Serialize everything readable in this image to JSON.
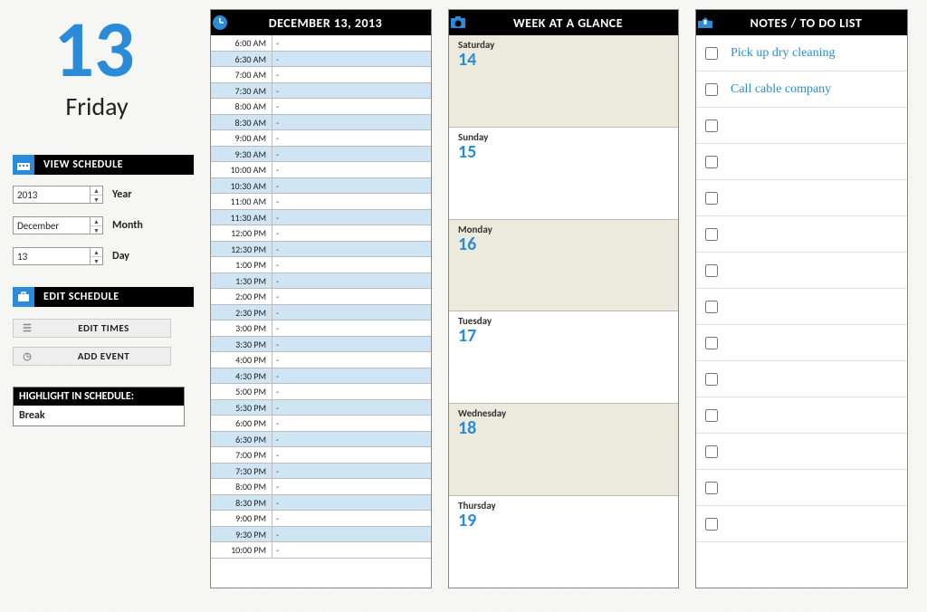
{
  "date": {
    "big": "13",
    "weekday": "Friday"
  },
  "view_schedule": {
    "title": "VIEW SCHEDULE",
    "year": {
      "value": "2013",
      "label": "Year"
    },
    "month": {
      "value": "December",
      "label": "Month"
    },
    "day": {
      "value": "13",
      "label": "Day"
    }
  },
  "edit_schedule": {
    "title": "EDIT SCHEDULE",
    "edit_times": "EDIT TIMES",
    "add_event": "ADD EVENT"
  },
  "highlight": {
    "title": "HIGHLIGHT IN SCHEDULE:",
    "value": "Break"
  },
  "schedule": {
    "title": "DECEMBER 13, 2013",
    "slots": [
      {
        "t": "6:00 AM",
        "e": "-"
      },
      {
        "t": "6:30 AM",
        "e": "-"
      },
      {
        "t": "7:00 AM",
        "e": "-"
      },
      {
        "t": "7:30 AM",
        "e": "-"
      },
      {
        "t": "8:00 AM",
        "e": "-"
      },
      {
        "t": "8:30 AM",
        "e": "-"
      },
      {
        "t": "9:00 AM",
        "e": "-"
      },
      {
        "t": "9:30 AM",
        "e": "-"
      },
      {
        "t": "10:00 AM",
        "e": "-"
      },
      {
        "t": "10:30 AM",
        "e": "-"
      },
      {
        "t": "11:00 AM",
        "e": "-"
      },
      {
        "t": "11:30 AM",
        "e": "-"
      },
      {
        "t": "12:00 PM",
        "e": "-"
      },
      {
        "t": "12:30 PM",
        "e": "-"
      },
      {
        "t": "1:00 PM",
        "e": "-"
      },
      {
        "t": "1:30 PM",
        "e": "-"
      },
      {
        "t": "2:00 PM",
        "e": "-"
      },
      {
        "t": "2:30 PM",
        "e": "-"
      },
      {
        "t": "3:00 PM",
        "e": "-"
      },
      {
        "t": "3:30 PM",
        "e": "-"
      },
      {
        "t": "4:00 PM",
        "e": "-"
      },
      {
        "t": "4:30 PM",
        "e": "-"
      },
      {
        "t": "5:00 PM",
        "e": "-"
      },
      {
        "t": "5:30 PM",
        "e": "-"
      },
      {
        "t": "6:00 PM",
        "e": "-"
      },
      {
        "t": "6:30 PM",
        "e": "-"
      },
      {
        "t": "7:00 PM",
        "e": "-"
      },
      {
        "t": "7:30 PM",
        "e": "-"
      },
      {
        "t": "8:00 PM",
        "e": "-"
      },
      {
        "t": "8:30 PM",
        "e": "-"
      },
      {
        "t": "9:00 PM",
        "e": "-"
      },
      {
        "t": "9:30 PM",
        "e": "-"
      },
      {
        "t": "10:00 PM",
        "e": "-"
      }
    ]
  },
  "week": {
    "title": "WEEK AT A GLANCE",
    "days": [
      {
        "name": "Saturday",
        "num": "14"
      },
      {
        "name": "Sunday",
        "num": "15"
      },
      {
        "name": "Monday",
        "num": "16"
      },
      {
        "name": "Tuesday",
        "num": "17"
      },
      {
        "name": "Wednesday",
        "num": "18"
      },
      {
        "name": "Thursday",
        "num": "19"
      }
    ]
  },
  "notes": {
    "title": "NOTES / TO DO LIST",
    "items": [
      {
        "done": false,
        "text": "Pick up dry cleaning"
      },
      {
        "done": false,
        "text": "Call cable company"
      },
      {
        "done": false,
        "text": ""
      },
      {
        "done": false,
        "text": ""
      },
      {
        "done": false,
        "text": ""
      },
      {
        "done": false,
        "text": ""
      },
      {
        "done": false,
        "text": ""
      },
      {
        "done": false,
        "text": ""
      },
      {
        "done": false,
        "text": ""
      },
      {
        "done": false,
        "text": ""
      },
      {
        "done": false,
        "text": ""
      },
      {
        "done": false,
        "text": ""
      },
      {
        "done": false,
        "text": ""
      },
      {
        "done": false,
        "text": ""
      }
    ]
  }
}
